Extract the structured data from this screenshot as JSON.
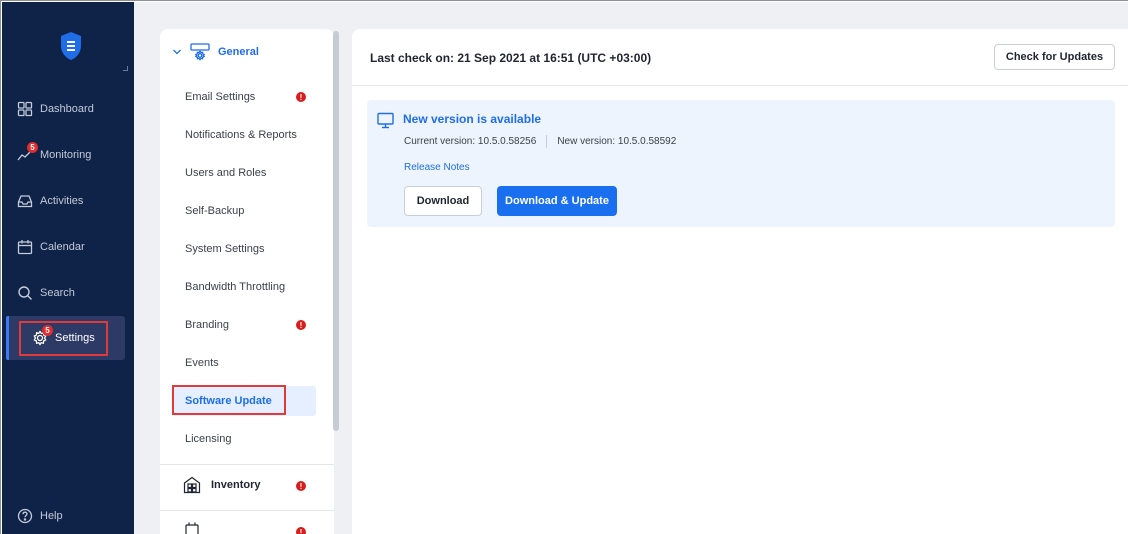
{
  "nav": {
    "items": [
      {
        "label": "Dashboard",
        "icon": "dashboard-icon"
      },
      {
        "label": "Monitoring",
        "icon": "monitoring-icon",
        "badge": "5"
      },
      {
        "label": "Activities",
        "icon": "activities-icon"
      },
      {
        "label": "Calendar",
        "icon": "calendar-icon"
      },
      {
        "label": "Search",
        "icon": "search-icon"
      },
      {
        "label": "Settings",
        "icon": "settings-icon",
        "badge": "5",
        "active": true
      }
    ],
    "help_label": "Help"
  },
  "settings_menu": {
    "general_label": "General",
    "items": [
      {
        "label": "Email Settings",
        "alert": "!"
      },
      {
        "label": "Notifications & Reports"
      },
      {
        "label": "Users and Roles"
      },
      {
        "label": "Self-Backup"
      },
      {
        "label": "System Settings"
      },
      {
        "label": "Bandwidth Throttling"
      },
      {
        "label": "Branding",
        "alert": "!"
      },
      {
        "label": "Events"
      },
      {
        "label": "Software Update",
        "active": true
      },
      {
        "label": "Licensing"
      }
    ],
    "inventory_label": "Inventory",
    "inventory_alert": "!",
    "transporters_alert": "!"
  },
  "main": {
    "last_check": "Last check on: 21 Sep 2021 at 16:51 (UTC +03:00)",
    "check_button": "Check for Updates",
    "update": {
      "title": "New version is available",
      "current_version": "Current version: 10.5.0.58256",
      "new_version": "New version: 10.5.0.58592",
      "release_notes": "Release Notes",
      "download_button": "Download",
      "download_update_button": "Download & Update"
    }
  },
  "colors": {
    "nav_bg": "#0f2248",
    "accent": "#1a6ff0",
    "alert": "#d91d1d",
    "highlight_outline": "#e03a3a"
  }
}
